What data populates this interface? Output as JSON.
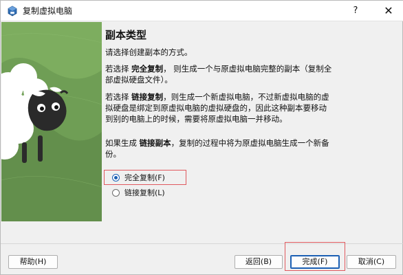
{
  "window": {
    "title": "复制虚拟电脑",
    "help_glyph": "?",
    "close_glyph": "✕",
    "app_icon": "virtualbox-icon",
    "accent": "#1a5fb4",
    "highlight": "#e0585d"
  },
  "illustration": {
    "icon": "sheep-illustration",
    "bg": "#7dad5f"
  },
  "content": {
    "heading": "副本类型",
    "intro": "请选择创建副本的方式。",
    "full_prefix": "若选择 ",
    "full_bold": "完全复制",
    "full_suffix": "， 则生成一个与原虚拟电脑完整的副本（复制全部虚拟硬盘文件）。",
    "linked_prefix": "若选择 ",
    "linked_bold": "链接复制",
    "linked_suffix": "，则生成一个新虚拟电脑，不过新虚拟电脑的虚拟硬盘是绑定到原虚拟电脑的虚拟硬盘的，因此这种副本要移动到别的电脑上的时候，需要将原虚拟电脑一并移动。",
    "snap_prefix": "如果生成 ",
    "snap_bold": "链接副本",
    "snap_suffix": "，复制的过程中将为原虚拟电脑生成一个新备份。"
  },
  "options": [
    {
      "label": "完全复制(F)",
      "checked": true
    },
    {
      "label": "链接复制(L)",
      "checked": false
    }
  ],
  "buttons": {
    "help": "帮助(H)",
    "back": "返回(B)",
    "finish": "完成(F)",
    "cancel": "取消(C)"
  }
}
